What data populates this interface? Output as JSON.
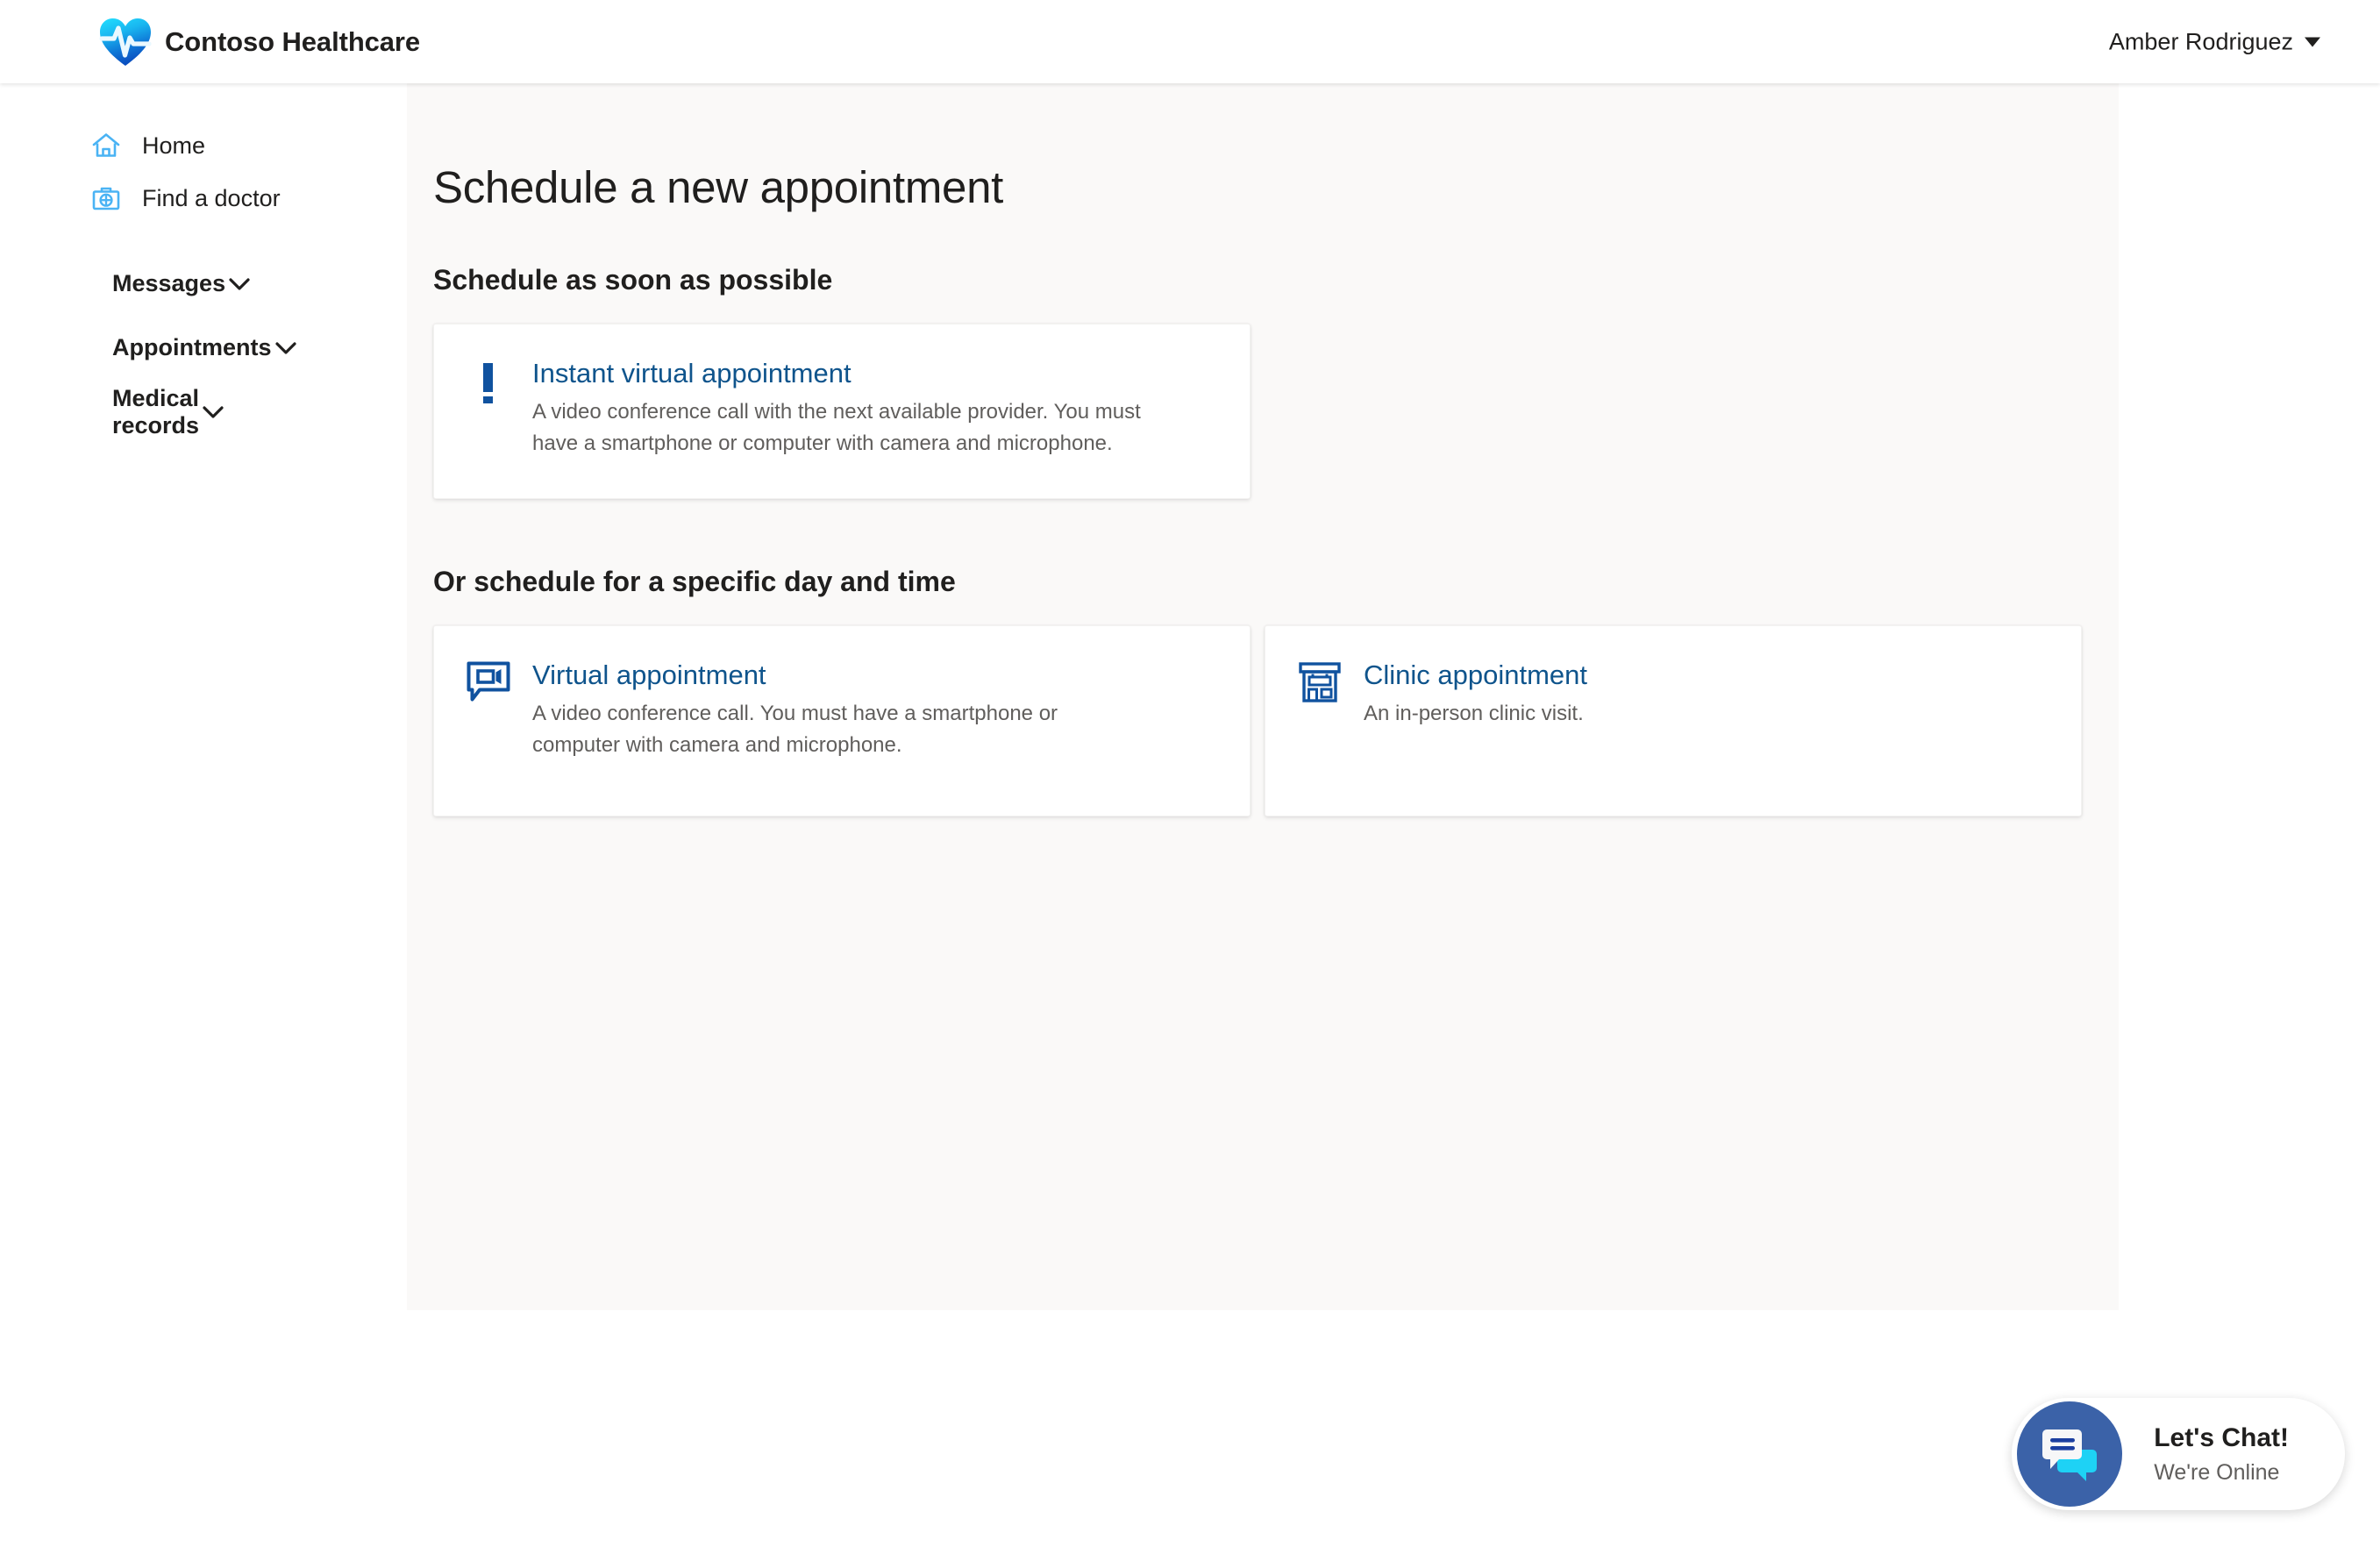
{
  "header": {
    "brand_name": "Contoso Healthcare",
    "logo_icon": "heart-pulse-icon",
    "account_name": "Amber Rodriguez",
    "account_caret_icon": "chevron-down-icon"
  },
  "sidebar": {
    "links": [
      {
        "label": "Home",
        "icon": "home-icon"
      },
      {
        "label": "Find a doctor",
        "icon": "medical-bag-icon"
      }
    ],
    "groups": [
      {
        "label": "Messages",
        "icon": "chevron-down-icon"
      },
      {
        "label": "Appointments",
        "icon": "chevron-down-icon"
      },
      {
        "label": "Medical records",
        "icon": "chevron-down-icon"
      }
    ]
  },
  "main": {
    "page_title": "Schedule a new appointment",
    "section_asap_title": "Schedule as soon as possible",
    "section_specific_title": "Or schedule for a specific day and time",
    "cards_asap": [
      {
        "icon": "exclamation-icon",
        "title": "Instant virtual appointment",
        "description": "A video conference call with the next available provider. You must have a smartphone or computer with camera and microphone."
      }
    ],
    "cards_specific": [
      {
        "icon": "video-chat-icon",
        "title": "Virtual appointment",
        "description": "A video conference call. You must have a smartphone or computer with camera and microphone."
      },
      {
        "icon": "clinic-building-icon",
        "title": "Clinic appointment",
        "description": "An in-person clinic visit."
      }
    ]
  },
  "chat": {
    "icon": "chat-bubbles-icon",
    "title": "Let's Chat!",
    "status": "We're Online"
  },
  "colors": {
    "link_blue": "#0f548c",
    "icon_blue": "#10529f",
    "sidebar_icon_blue": "#4ab3f4",
    "content_bg": "#faf9f8",
    "text_primary": "#201f1e",
    "text_secondary": "#605e5c",
    "chat_circle": "#3b62a8",
    "chat_bubble_cyan": "#1ed2f5"
  }
}
